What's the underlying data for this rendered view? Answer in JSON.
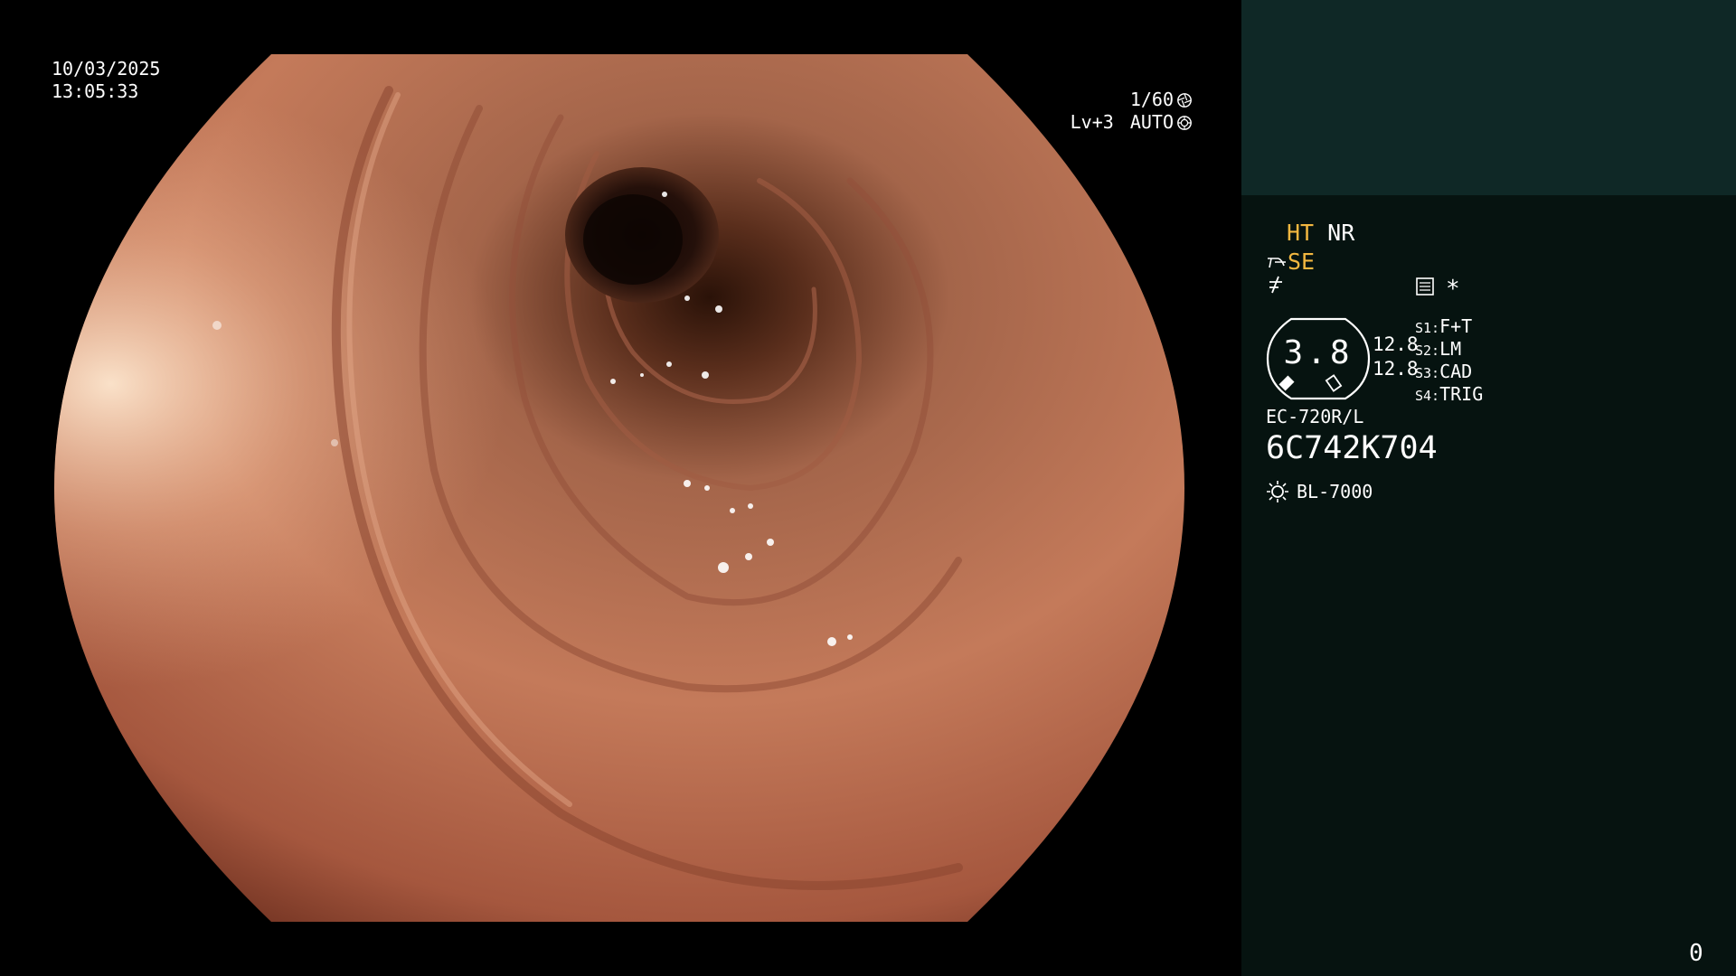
{
  "overlay": {
    "date": "10/03/2025",
    "time": "13:05:33",
    "shutter": "1/60",
    "iris_level": "Lv+3",
    "iris_mode": "AUTO",
    "shutter_icon": "aperture-icon",
    "iris_icon": "iris-auto-icon"
  },
  "panel": {
    "ht_label": "HT",
    "nr_label": "NR",
    "se_label": "SE",
    "enhance_icon": "structure-enhance-icon",
    "freeze_icon": "freeze-icon",
    "memory_icon": "memory-card-icon",
    "star": "*",
    "gauge_value": "3.8",
    "zoom_a": "12.8",
    "zoom_b": "12.8",
    "switches": [
      {
        "key": "S1:",
        "value": "F+T"
      },
      {
        "key": "S2:",
        "value": "LM"
      },
      {
        "key": "S3:",
        "value": "CAD"
      },
      {
        "key": "S4:",
        "value": "TRIG"
      }
    ],
    "scope_model": "EC-720R/L",
    "serial": "6C742K704",
    "light_source": "BL-7000",
    "light_icon": "light-source-icon",
    "counter": "0"
  },
  "colors": {
    "panel_bg": "#061310",
    "panel_top_bg": "#0f2826",
    "accent_yellow": "#f2b740"
  }
}
